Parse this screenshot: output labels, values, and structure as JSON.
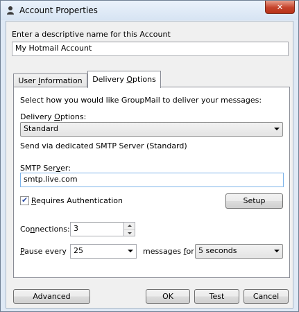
{
  "window": {
    "title": "Account Properties",
    "close_symbol": "✕"
  },
  "account": {
    "name_label": "Enter a descriptive name for this Account",
    "name_value": "My Hotmail Account"
  },
  "tabs": {
    "user_info": {
      "pre": "User ",
      "u": "I",
      "post": "nformation"
    },
    "delivery": {
      "pre": "Delivery ",
      "u": "O",
      "post": "ptions"
    }
  },
  "delivery": {
    "intro": "Select how you would like GroupMail to deliver your messages:",
    "options_label": {
      "pre": "Delivery ",
      "u": "O",
      "post": "ptions:"
    },
    "selected_option": "Standard",
    "description": "Send via dedicated SMTP Server (Standard)",
    "smtp_label": {
      "pre": "SMTP Ser",
      "u": "v",
      "post": "er:"
    },
    "smtp_value": "smtp.live.com",
    "requires_auth": {
      "pre": "",
      "u": "R",
      "post": "equires Authentication",
      "checked": true,
      "check_glyph": "✔"
    },
    "setup_button": "Setup",
    "connections_label": {
      "pre": "Co",
      "u": "n",
      "post": "nections:"
    },
    "connections_value": "3",
    "pause_label": {
      "pre": "",
      "u": "P",
      "post": "ause every"
    },
    "pause_value": "25",
    "messages_for_label": {
      "pre": "messages ",
      "u": "f",
      "post": "or"
    },
    "interval_value": "5 seconds"
  },
  "footer": {
    "advanced": "Advanced",
    "ok": "OK",
    "test": "Test",
    "cancel": "Cancel"
  },
  "colors": {
    "frame": "#dfe9f5",
    "close_red": "#c5432b",
    "check": "#2f4fa8"
  }
}
